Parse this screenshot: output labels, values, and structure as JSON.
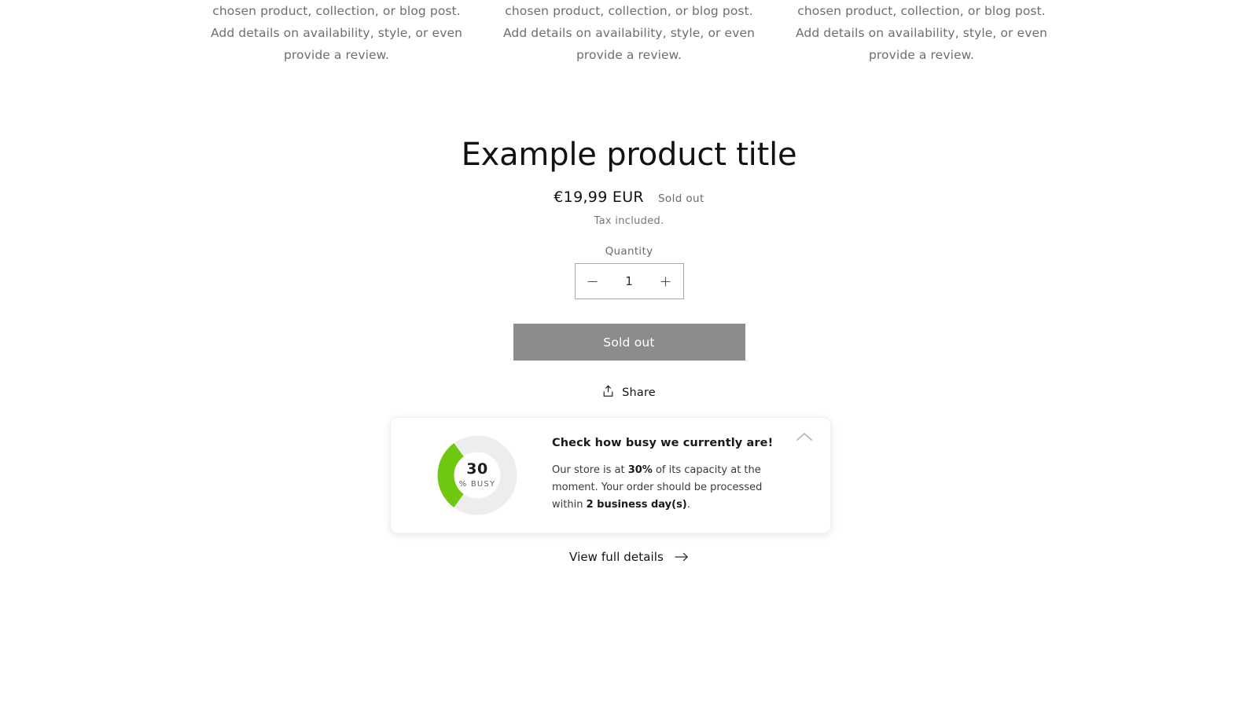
{
  "top_columns": [
    {
      "text": "chosen product, collection, or blog post. Add details on availability, style, or even provide a review."
    },
    {
      "text": "chosen product, collection, or blog post. Add details on availability, style, or even provide a review."
    },
    {
      "text": "chosen product, collection, or blog post. Add details on availability, style, or even provide a review."
    }
  ],
  "product": {
    "title": "Example product title",
    "price": "€19,99 EUR",
    "availability_badge": "Sold out",
    "tax_note": "Tax included.",
    "quantity_label": "Quantity",
    "quantity_value": "1",
    "decrease_icon": "minus-icon",
    "increase_icon": "plus-icon",
    "cta_label": "Sold out",
    "cta_color": "#8c8c8c",
    "share_label": "Share",
    "share_icon": "share-icon",
    "view_details_label": "View full details",
    "view_details_icon": "arrow-right-icon"
  },
  "busy_widget": {
    "heading": "Check how busy we currently are!",
    "body_prefix": "Our store is at ",
    "capacity_value": "30%",
    "body_middle": " of its capacity at the moment. Your order should be processed within ",
    "processing_time": "2 business day(s)",
    "body_suffix": ".",
    "collapse_icon": "chevron-up-icon",
    "gauge": {
      "value": "30",
      "unit": "% BUSY",
      "percent": 30,
      "arc_color": "#6fc80f",
      "track_color": "#ededed"
    }
  }
}
